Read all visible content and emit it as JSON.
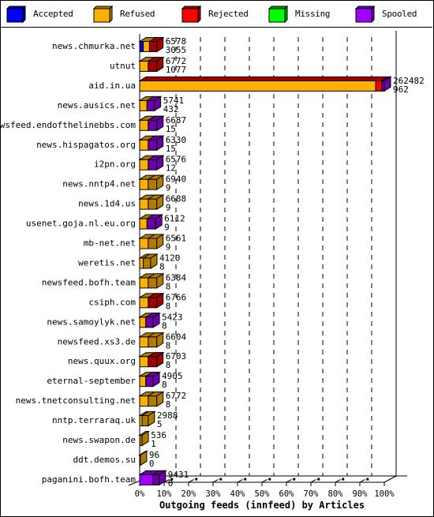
{
  "chart_data": {
    "type": "bar",
    "orientation": "horizontal",
    "stacked": true,
    "title": "Outgoing feeds (innfeed) by Articles",
    "xlabel": "Outgoing feeds (innfeed) by Articles",
    "ylabel": "",
    "xlim": [
      0,
      100
    ],
    "x_unit": "%",
    "x_ticks": [
      "0%",
      "10%",
      "20%",
      "30%",
      "40%",
      "50%",
      "60%",
      "70%",
      "80%",
      "90%",
      "100%"
    ],
    "grid": "vertical dashed",
    "legend_position": "top",
    "legend": [
      {
        "name": "Accepted",
        "color": "#0000ff",
        "dark": "#0000a0"
      },
      {
        "name": "Refused",
        "color": "#ffb000",
        "dark": "#b07c00"
      },
      {
        "name": "Rejected",
        "color": "#ff0000",
        "dark": "#a00000"
      },
      {
        "name": "Missing",
        "color": "#00ff00",
        "dark": "#00a000"
      },
      {
        "name": "Spooled",
        "color": "#a000ff",
        "dark": "#6a00a8"
      }
    ],
    "categories": [
      "news.chmurka.net",
      "utnut",
      "aid.in.ua",
      "news.ausics.net",
      "newsfeed.endofthelinebbs.com",
      "news.hispagatos.org",
      "i2pn.org",
      "news.nntp4.net",
      "news.1d4.us",
      "usenet.goja.nl.eu.org",
      "mb-net.net",
      "weretis.net",
      "newsfeed.bofh.team",
      "csiph.com",
      "news.samoylyk.net",
      "newsfeed.xs3.de",
      "news.quux.org",
      "eternal-september",
      "news.tnetconsulting.net",
      "nntp.terraraq.uk",
      "news.swapon.de",
      "ddt.demos.su",
      "paganini.bofh.team"
    ],
    "top_values": [
      6578,
      6772,
      262482,
      5741,
      6687,
      6330,
      6576,
      6940,
      6688,
      6112,
      6561,
      4120,
      6384,
      6766,
      5423,
      6604,
      6703,
      4905,
      6772,
      2988,
      536,
      96,
      9431
    ],
    "bottom_values": [
      3055,
      1077,
      962,
      432,
      15,
      15,
      12,
      9,
      9,
      9,
      9,
      8,
      8,
      8,
      8,
      8,
      8,
      8,
      8,
      5,
      1,
      0,
      0
    ],
    "series": [
      {
        "name": "Accepted",
        "values": [
          1.5,
          0,
          0,
          0,
          0,
          0,
          0,
          0,
          0,
          0,
          0,
          0,
          0,
          0,
          0,
          0,
          0,
          0,
          0,
          0,
          0,
          0,
          0
        ]
      },
      {
        "name": "Refused",
        "values": [
          2.5,
          3.5,
          96.5,
          3.0,
          3.5,
          3.5,
          3.5,
          3.5,
          3.5,
          3.0,
          3.5,
          1.5,
          3.5,
          3.5,
          2.5,
          3.5,
          3.5,
          2.5,
          3.5,
          1.0,
          0,
          0,
          0
        ]
      },
      {
        "name": "Rejected",
        "values": [
          0,
          0,
          2.5,
          0,
          0,
          0,
          0,
          0,
          0,
          0,
          0,
          0,
          0,
          0,
          0,
          0,
          0,
          0,
          0,
          0,
          0,
          0,
          0
        ]
      },
      {
        "name": "Missing",
        "values": [
          0,
          0,
          0,
          0,
          0,
          0,
          0,
          0,
          0,
          0,
          0,
          0,
          0,
          0,
          0,
          0,
          0,
          0,
          0,
          0,
          0,
          0,
          0
        ]
      },
      {
        "name": "Spooled",
        "values": [
          0,
          0,
          0,
          0,
          0,
          0,
          0,
          0,
          0,
          0,
          0,
          0,
          0,
          0,
          0,
          0,
          0,
          0,
          0,
          0,
          0,
          0,
          5.5
        ]
      }
    ],
    "bar_top_color_by_row": [
      "Rejected",
      "Rejected",
      "Spooled",
      "Spooled",
      "Spooled",
      "Spooled",
      "Spooled",
      "Refused",
      "Refused",
      "Spooled",
      "Refused",
      "Refused",
      "Refused",
      "Rejected",
      "Spooled",
      "Refused",
      "Rejected",
      "Spooled",
      "Refused",
      "Refused",
      "Refused",
      "Refused",
      "Spooled"
    ],
    "bar_total_pct": [
      7.0,
      7.0,
      100,
      6.0,
      7.0,
      7.0,
      7.0,
      7.0,
      7.0,
      6.5,
      7.0,
      4.5,
      7.0,
      7.0,
      5.5,
      7.0,
      7.0,
      5.5,
      7.0,
      3.5,
      1.0,
      0.3,
      8.0
    ]
  }
}
